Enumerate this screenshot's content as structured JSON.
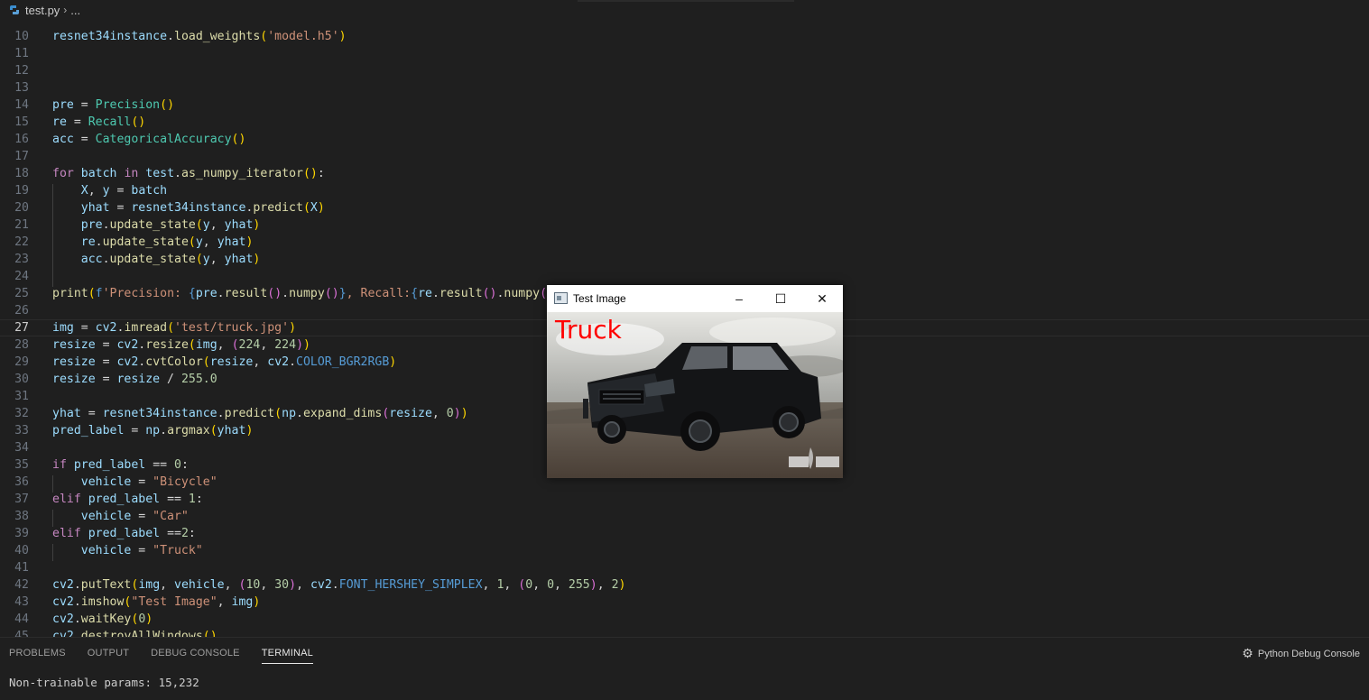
{
  "breadcrumb": {
    "file": "test.py",
    "rest": "..."
  },
  "editor": {
    "current_line": 27,
    "lines": [
      {
        "n": "10",
        "tokens": [
          [
            "v",
            "resnet34instance"
          ],
          [
            "o",
            "."
          ],
          [
            "f",
            "load_weights"
          ],
          [
            "p1",
            "("
          ],
          [
            "s",
            "'model.h5'"
          ],
          [
            "p1",
            ")"
          ]
        ]
      },
      {
        "n": "11",
        "tokens": []
      },
      {
        "n": "12",
        "tokens": []
      },
      {
        "n": "13",
        "tokens": []
      },
      {
        "n": "14",
        "tokens": [
          [
            "v",
            "pre"
          ],
          [
            "o",
            " = "
          ],
          [
            "c",
            "Precision"
          ],
          [
            "p1",
            "()"
          ]
        ]
      },
      {
        "n": "15",
        "tokens": [
          [
            "v",
            "re"
          ],
          [
            "o",
            " = "
          ],
          [
            "c",
            "Recall"
          ],
          [
            "p1",
            "()"
          ]
        ]
      },
      {
        "n": "16",
        "tokens": [
          [
            "v",
            "acc"
          ],
          [
            "o",
            " = "
          ],
          [
            "c",
            "CategoricalAccuracy"
          ],
          [
            "p1",
            "()"
          ]
        ]
      },
      {
        "n": "17",
        "tokens": []
      },
      {
        "n": "18",
        "tokens": [
          [
            "k",
            "for"
          ],
          [
            "o",
            " "
          ],
          [
            "v",
            "batch"
          ],
          [
            "o",
            " "
          ],
          [
            "k",
            "in"
          ],
          [
            "o",
            " "
          ],
          [
            "v",
            "test"
          ],
          [
            "o",
            "."
          ],
          [
            "f",
            "as_numpy_iterator"
          ],
          [
            "p1",
            "()"
          ],
          [
            "o",
            ":"
          ]
        ]
      },
      {
        "n": "19",
        "tokens": [
          [
            "o",
            "    "
          ],
          [
            "v",
            "X"
          ],
          [
            "o",
            ", "
          ],
          [
            "v",
            "y"
          ],
          [
            "o",
            " = "
          ],
          [
            "v",
            "batch"
          ]
        ]
      },
      {
        "n": "20",
        "tokens": [
          [
            "o",
            "    "
          ],
          [
            "v",
            "yhat"
          ],
          [
            "o",
            " = "
          ],
          [
            "v",
            "resnet34instance"
          ],
          [
            "o",
            "."
          ],
          [
            "f",
            "predict"
          ],
          [
            "p1",
            "("
          ],
          [
            "v",
            "X"
          ],
          [
            "p1",
            ")"
          ]
        ]
      },
      {
        "n": "21",
        "tokens": [
          [
            "o",
            "    "
          ],
          [
            "v",
            "pre"
          ],
          [
            "o",
            "."
          ],
          [
            "f",
            "update_state"
          ],
          [
            "p1",
            "("
          ],
          [
            "v",
            "y"
          ],
          [
            "o",
            ", "
          ],
          [
            "v",
            "yhat"
          ],
          [
            "p1",
            ")"
          ]
        ]
      },
      {
        "n": "22",
        "tokens": [
          [
            "o",
            "    "
          ],
          [
            "v",
            "re"
          ],
          [
            "o",
            "."
          ],
          [
            "f",
            "update_state"
          ],
          [
            "p1",
            "("
          ],
          [
            "v",
            "y"
          ],
          [
            "o",
            ", "
          ],
          [
            "v",
            "yhat"
          ],
          [
            "p1",
            ")"
          ]
        ]
      },
      {
        "n": "23",
        "tokens": [
          [
            "o",
            "    "
          ],
          [
            "v",
            "acc"
          ],
          [
            "o",
            "."
          ],
          [
            "f",
            "update_state"
          ],
          [
            "p1",
            "("
          ],
          [
            "v",
            "y"
          ],
          [
            "o",
            ", "
          ],
          [
            "v",
            "yhat"
          ],
          [
            "p1",
            ")"
          ]
        ]
      },
      {
        "n": "24",
        "tokens": []
      },
      {
        "n": "25",
        "tokens": [
          [
            "f",
            "print"
          ],
          [
            "p1",
            "("
          ],
          [
            "b",
            "f"
          ],
          [
            "s",
            "'Precision: "
          ],
          [
            "b",
            "{"
          ],
          [
            "v",
            "pre"
          ],
          [
            "o",
            "."
          ],
          [
            "f",
            "result"
          ],
          [
            "p2",
            "()"
          ],
          [
            "o",
            "."
          ],
          [
            "f",
            "numpy"
          ],
          [
            "p2",
            "()"
          ],
          [
            "b",
            "}"
          ],
          [
            "s",
            ", Recall:"
          ],
          [
            "b",
            "{"
          ],
          [
            "v",
            "re"
          ],
          [
            "o",
            "."
          ],
          [
            "f",
            "result"
          ],
          [
            "p2",
            "()"
          ],
          [
            "o",
            "."
          ],
          [
            "f",
            "numpy"
          ],
          [
            "p2",
            "()"
          ],
          [
            "b",
            "}"
          ]
        ]
      },
      {
        "n": "26",
        "tokens": []
      },
      {
        "n": "27",
        "tokens": [
          [
            "v",
            "img"
          ],
          [
            "o",
            " = "
          ],
          [
            "v",
            "cv2"
          ],
          [
            "o",
            "."
          ],
          [
            "f",
            "imread"
          ],
          [
            "p1",
            "("
          ],
          [
            "s",
            "'test/truck.jpg'"
          ],
          [
            "p1",
            ")"
          ]
        ]
      },
      {
        "n": "28",
        "tokens": [
          [
            "v",
            "resize"
          ],
          [
            "o",
            " = "
          ],
          [
            "v",
            "cv2"
          ],
          [
            "o",
            "."
          ],
          [
            "f",
            "resize"
          ],
          [
            "p1",
            "("
          ],
          [
            "v",
            "img"
          ],
          [
            "o",
            ", "
          ],
          [
            "p2",
            "("
          ],
          [
            "n",
            "224"
          ],
          [
            "o",
            ", "
          ],
          [
            "n",
            "224"
          ],
          [
            "p2",
            ")"
          ],
          [
            "p1",
            ")"
          ]
        ]
      },
      {
        "n": "29",
        "tokens": [
          [
            "v",
            "resize"
          ],
          [
            "o",
            " = "
          ],
          [
            "v",
            "cv2"
          ],
          [
            "o",
            "."
          ],
          [
            "f",
            "cvtColor"
          ],
          [
            "p1",
            "("
          ],
          [
            "v",
            "resize"
          ],
          [
            "o",
            ", "
          ],
          [
            "v",
            "cv2"
          ],
          [
            "o",
            "."
          ],
          [
            "b",
            "COLOR_BGR2RGB"
          ],
          [
            "p1",
            ")"
          ]
        ]
      },
      {
        "n": "30",
        "tokens": [
          [
            "v",
            "resize"
          ],
          [
            "o",
            " = "
          ],
          [
            "v",
            "resize"
          ],
          [
            "o",
            " / "
          ],
          [
            "n",
            "255.0"
          ]
        ]
      },
      {
        "n": "31",
        "tokens": []
      },
      {
        "n": "32",
        "tokens": [
          [
            "v",
            "yhat"
          ],
          [
            "o",
            " = "
          ],
          [
            "v",
            "resnet34instance"
          ],
          [
            "o",
            "."
          ],
          [
            "f",
            "predict"
          ],
          [
            "p1",
            "("
          ],
          [
            "v",
            "np"
          ],
          [
            "o",
            "."
          ],
          [
            "f",
            "expand_dims"
          ],
          [
            "p2",
            "("
          ],
          [
            "v",
            "resize"
          ],
          [
            "o",
            ", "
          ],
          [
            "n",
            "0"
          ],
          [
            "p2",
            ")"
          ],
          [
            "p1",
            ")"
          ]
        ]
      },
      {
        "n": "33",
        "tokens": [
          [
            "v",
            "pred_label"
          ],
          [
            "o",
            " = "
          ],
          [
            "v",
            "np"
          ],
          [
            "o",
            "."
          ],
          [
            "f",
            "argmax"
          ],
          [
            "p1",
            "("
          ],
          [
            "v",
            "yhat"
          ],
          [
            "p1",
            ")"
          ]
        ]
      },
      {
        "n": "34",
        "tokens": []
      },
      {
        "n": "35",
        "tokens": [
          [
            "k",
            "if"
          ],
          [
            "o",
            " "
          ],
          [
            "v",
            "pred_label"
          ],
          [
            "o",
            " == "
          ],
          [
            "n",
            "0"
          ],
          [
            "o",
            ":"
          ]
        ]
      },
      {
        "n": "36",
        "tokens": [
          [
            "o",
            "    "
          ],
          [
            "v",
            "vehicle"
          ],
          [
            "o",
            " = "
          ],
          [
            "s",
            "\"Bicycle\""
          ]
        ]
      },
      {
        "n": "37",
        "tokens": [
          [
            "k",
            "elif"
          ],
          [
            "o",
            " "
          ],
          [
            "v",
            "pred_label"
          ],
          [
            "o",
            " == "
          ],
          [
            "n",
            "1"
          ],
          [
            "o",
            ":"
          ]
        ]
      },
      {
        "n": "38",
        "tokens": [
          [
            "o",
            "    "
          ],
          [
            "v",
            "vehicle"
          ],
          [
            "o",
            " = "
          ],
          [
            "s",
            "\"Car\""
          ]
        ]
      },
      {
        "n": "39",
        "tokens": [
          [
            "k",
            "elif"
          ],
          [
            "o",
            " "
          ],
          [
            "v",
            "pred_label"
          ],
          [
            "o",
            " =="
          ],
          [
            "n",
            "2"
          ],
          [
            "o",
            ":"
          ]
        ]
      },
      {
        "n": "40",
        "tokens": [
          [
            "o",
            "    "
          ],
          [
            "v",
            "vehicle"
          ],
          [
            "o",
            " = "
          ],
          [
            "s",
            "\"Truck\""
          ]
        ]
      },
      {
        "n": "41",
        "tokens": []
      },
      {
        "n": "42",
        "tokens": [
          [
            "v",
            "cv2"
          ],
          [
            "o",
            "."
          ],
          [
            "f",
            "putText"
          ],
          [
            "p1",
            "("
          ],
          [
            "v",
            "img"
          ],
          [
            "o",
            ", "
          ],
          [
            "v",
            "vehicle"
          ],
          [
            "o",
            ", "
          ],
          [
            "p2",
            "("
          ],
          [
            "n",
            "10"
          ],
          [
            "o",
            ", "
          ],
          [
            "n",
            "30"
          ],
          [
            "p2",
            ")"
          ],
          [
            "o",
            ", "
          ],
          [
            "v",
            "cv2"
          ],
          [
            "o",
            "."
          ],
          [
            "b",
            "FONT_HERSHEY_SIMPLEX"
          ],
          [
            "o",
            ", "
          ],
          [
            "n",
            "1"
          ],
          [
            "o",
            ", "
          ],
          [
            "p2",
            "("
          ],
          [
            "n",
            "0"
          ],
          [
            "o",
            ", "
          ],
          [
            "n",
            "0"
          ],
          [
            "o",
            ", "
          ],
          [
            "n",
            "255"
          ],
          [
            "p2",
            ")"
          ],
          [
            "o",
            ", "
          ],
          [
            "n",
            "2"
          ],
          [
            "p1",
            ")"
          ]
        ]
      },
      {
        "n": "43",
        "tokens": [
          [
            "v",
            "cv2"
          ],
          [
            "o",
            "."
          ],
          [
            "f",
            "imshow"
          ],
          [
            "p1",
            "("
          ],
          [
            "s",
            "\"Test Image\""
          ],
          [
            "o",
            ", "
          ],
          [
            "v",
            "img"
          ],
          [
            "p1",
            ")"
          ]
        ]
      },
      {
        "n": "44",
        "tokens": [
          [
            "v",
            "cv2"
          ],
          [
            "o",
            "."
          ],
          [
            "f",
            "waitKey"
          ],
          [
            "p1",
            "("
          ],
          [
            "n",
            "0"
          ],
          [
            "p1",
            ")"
          ]
        ]
      },
      {
        "n": "45",
        "tokens": [
          [
            "v",
            "cv2"
          ],
          [
            "o",
            "."
          ],
          [
            "f",
            "destroyAllWindows"
          ],
          [
            "p1",
            "()"
          ]
        ]
      }
    ]
  },
  "panel": {
    "tabs": [
      {
        "label": "PROBLEMS",
        "active": false
      },
      {
        "label": "OUTPUT",
        "active": false
      },
      {
        "label": "DEBUG CONSOLE",
        "active": false
      },
      {
        "label": "TERMINAL",
        "active": true
      }
    ],
    "debug_console_label": "Python Debug Console",
    "terminal_text": "Non-trainable params: 15,232"
  },
  "image_window": {
    "title": "Test Image",
    "label": "Truck"
  }
}
